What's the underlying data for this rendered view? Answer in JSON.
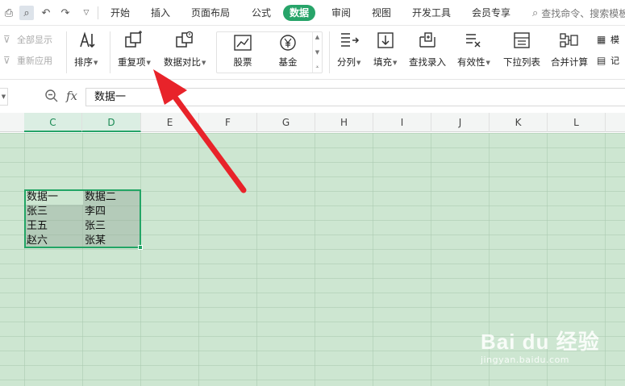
{
  "menubar": {
    "tabs": [
      "开始",
      "插入",
      "页面布局",
      "公式",
      "数据",
      "审阅",
      "视图",
      "开发工具",
      "会员专享"
    ],
    "active_tab": "数据",
    "search_placeholder": "查找命令、搜索模板"
  },
  "ribbon": {
    "show_all": "全部显示",
    "reapply": "重新应用",
    "sort": "排序",
    "duplicates": "重复项",
    "compare": "数据对比",
    "stocks": "股票",
    "funds": "基金",
    "split": "分列",
    "fill": "填充",
    "lookup": "查找录入",
    "validity": "有效性",
    "dropdown": "下拉列表",
    "merge_calc": "合并计算",
    "simulate": "模",
    "record": "记"
  },
  "formula_bar": {
    "fx": "fx",
    "value": "数据一"
  },
  "columns": [
    "C",
    "D",
    "E",
    "F",
    "G",
    "H",
    "I",
    "J",
    "K",
    "L"
  ],
  "selected_columns": [
    "C",
    "D"
  ],
  "cells": {
    "col_c": [
      "数据一",
      "张三",
      "王五",
      "赵六"
    ],
    "col_d": [
      "数据二",
      "李四",
      "张三",
      "张某"
    ]
  },
  "watermark": {
    "brand": "Bai du 经验",
    "url": "jingyan.baidu.com"
  },
  "colors": {
    "accent": "#27a469",
    "sheet_bg": "#cde6d1",
    "arrow": "#e8232a"
  }
}
